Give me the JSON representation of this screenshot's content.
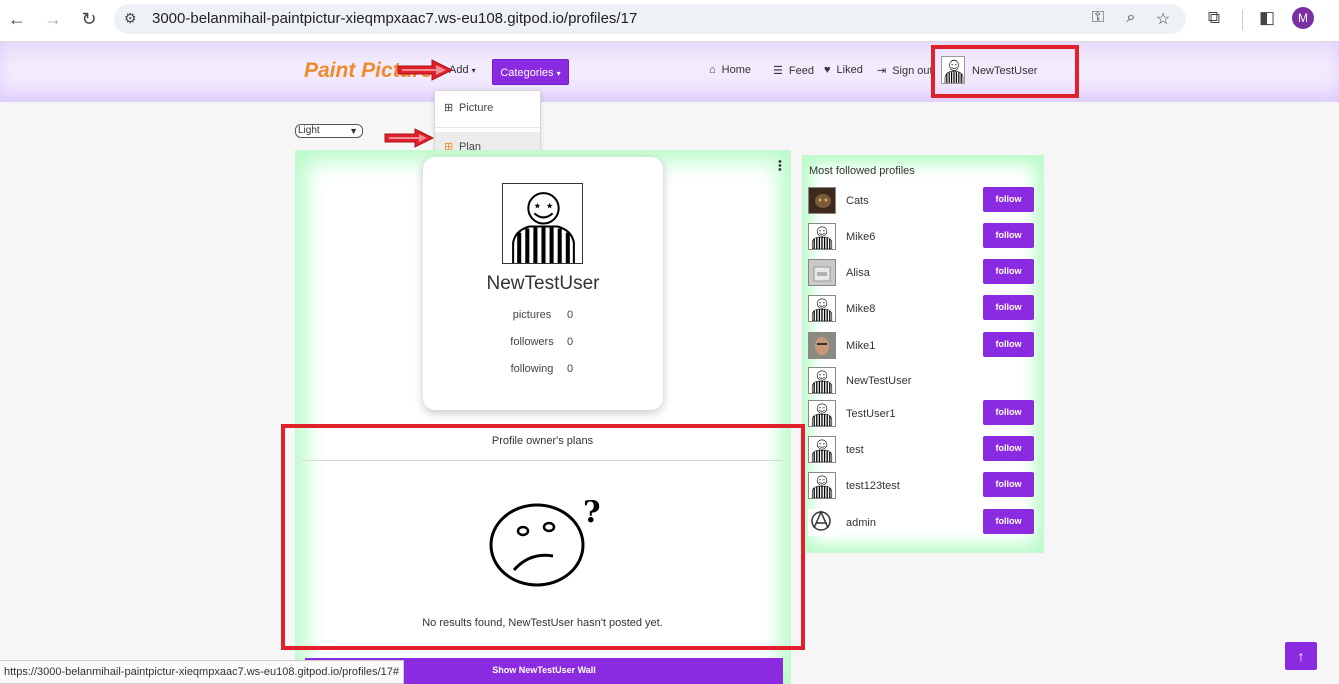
{
  "browser": {
    "url": "3000-belanmihail-paintpictur-xieqmpxaac7.ws-eu108.gitpod.io/profiles/17",
    "profile_initial": "M",
    "status_url": "https://3000-belanmihail-paintpictur-xieqmpxaac7.ws-eu108.gitpod.io/profiles/17#"
  },
  "navbar": {
    "brand": "Paint Picture",
    "add_label": "Add",
    "categories_label": "Categories",
    "links": {
      "home": "Home",
      "feed": "Feed",
      "liked": "Liked",
      "signout": "Sign out"
    },
    "username": "NewTestUser"
  },
  "add_menu": {
    "picture": "Picture",
    "plan": "Plan"
  },
  "theme": {
    "selected": "Light"
  },
  "profile": {
    "name": "NewTestUser",
    "stats": [
      {
        "label": "pictures",
        "value": "0"
      },
      {
        "label": "followers",
        "value": "0"
      },
      {
        "label": "following",
        "value": "0"
      }
    ]
  },
  "plans": {
    "title": "Profile owner's plans",
    "empty_message": "No results found, NewTestUser hasn't posted yet."
  },
  "wall_button": "Show NewTestUser Wall",
  "side": {
    "title": "Most followed profiles",
    "follow_label": "follow",
    "profiles": [
      {
        "name": "Cats",
        "avatar": "cat-photo",
        "follow": true
      },
      {
        "name": "Mike6",
        "avatar": "striped-default",
        "follow": true
      },
      {
        "name": "Alisa",
        "avatar": "alisa-photo",
        "follow": true
      },
      {
        "name": "Mike8",
        "avatar": "striped-default",
        "follow": true
      },
      {
        "name": "Mike1",
        "avatar": "face-photo",
        "follow": true
      },
      {
        "name": "NewTestUser",
        "avatar": "striped-default",
        "follow": false
      },
      {
        "name": "TestUser1",
        "avatar": "striped-default",
        "follow": true
      },
      {
        "name": "test",
        "avatar": "striped-default",
        "follow": true
      },
      {
        "name": "test123test",
        "avatar": "striped-default",
        "follow": true
      },
      {
        "name": "admin",
        "avatar": "anarchy-icon",
        "follow": true
      }
    ]
  },
  "colors": {
    "accent": "#8a2be2",
    "brand": "#f08a2c",
    "annotation": "#e0202a",
    "panel_glow": "#b8fbc8"
  }
}
